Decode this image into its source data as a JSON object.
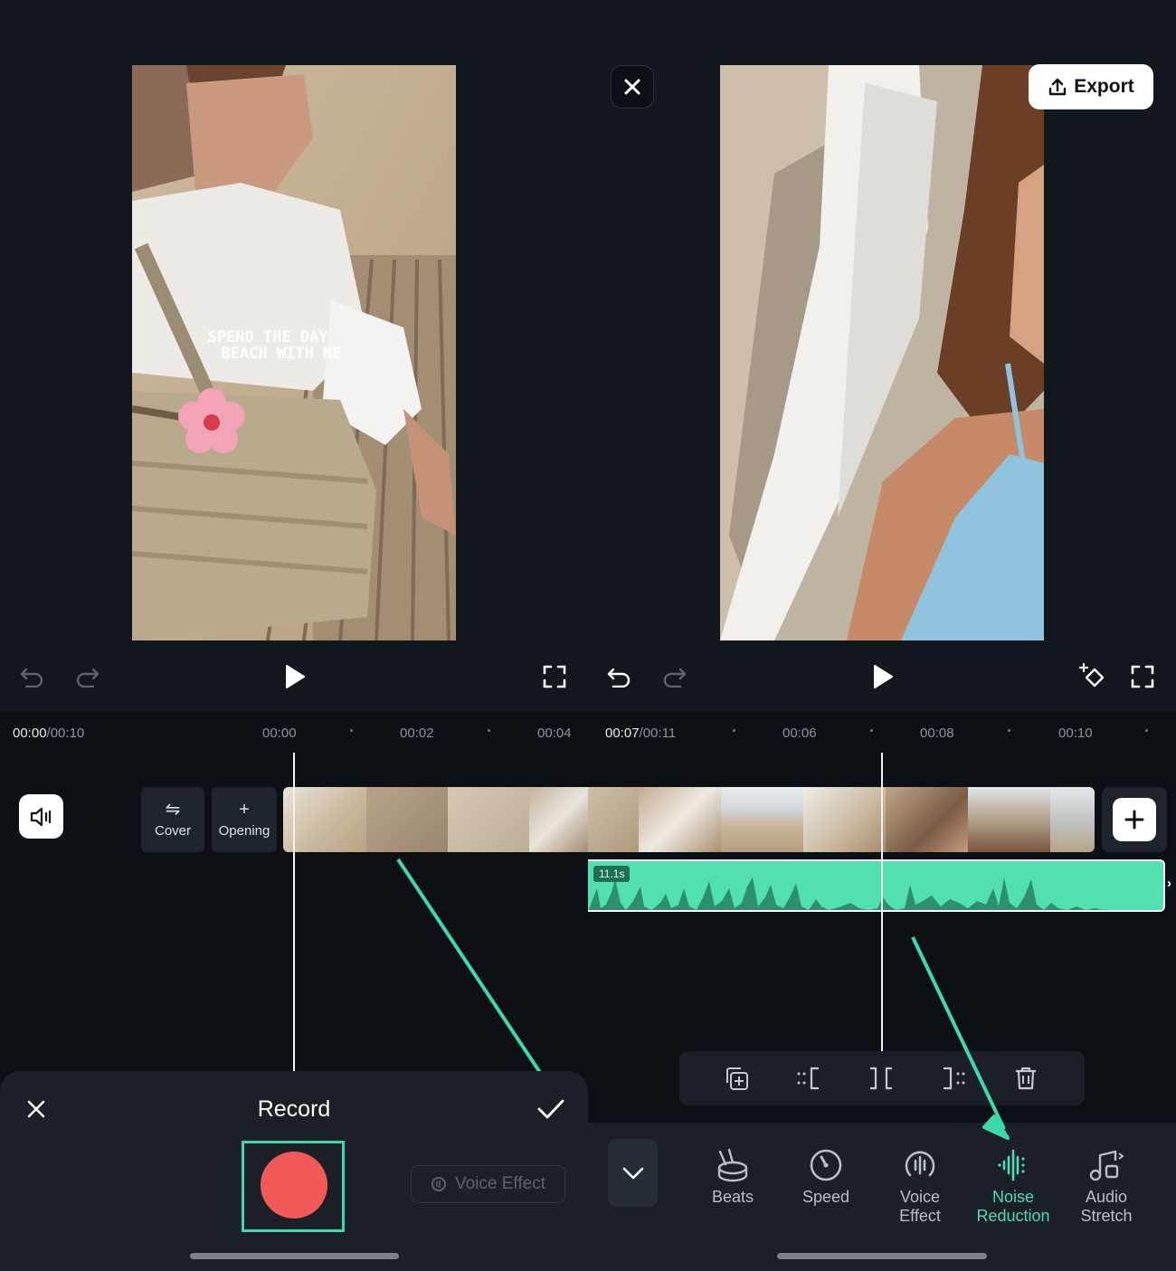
{
  "left": {
    "video_overlay_text": [
      "SPEND THE DAY",
      "BEACH WITH ME"
    ],
    "timecode": {
      "current": "00:00",
      "total": "/00:10"
    },
    "ruler": [
      "00:00",
      "00:02",
      "00:04"
    ],
    "cover_label": "Cover",
    "opening_label": "Opening",
    "record_title": "Record",
    "voice_effect_label": "Voice Effect"
  },
  "right": {
    "export_label": "Export",
    "timecode": {
      "current": "00:07",
      "total": "/00:11"
    },
    "ruler": [
      "00:06",
      "00:08",
      "00:10"
    ],
    "clip_duration": "11.1s",
    "tools": [
      {
        "label_1": "Beats",
        "label_2": "",
        "icon": "beats-icon"
      },
      {
        "label_1": "Speed",
        "label_2": "",
        "icon": "speed-icon"
      },
      {
        "label_1": "Voice",
        "label_2": "Effect",
        "icon": "voice-effect-icon"
      },
      {
        "label_1": "Noise",
        "label_2": "Reduction",
        "icon": "noise-reduction-icon"
      },
      {
        "label_1": "Audio",
        "label_2": "Stretch",
        "icon": "audio-stretch-icon"
      }
    ]
  },
  "colors": {
    "accent": "#4fd9b8",
    "record": "#f25a5a",
    "waveform": "#52e0b0"
  }
}
